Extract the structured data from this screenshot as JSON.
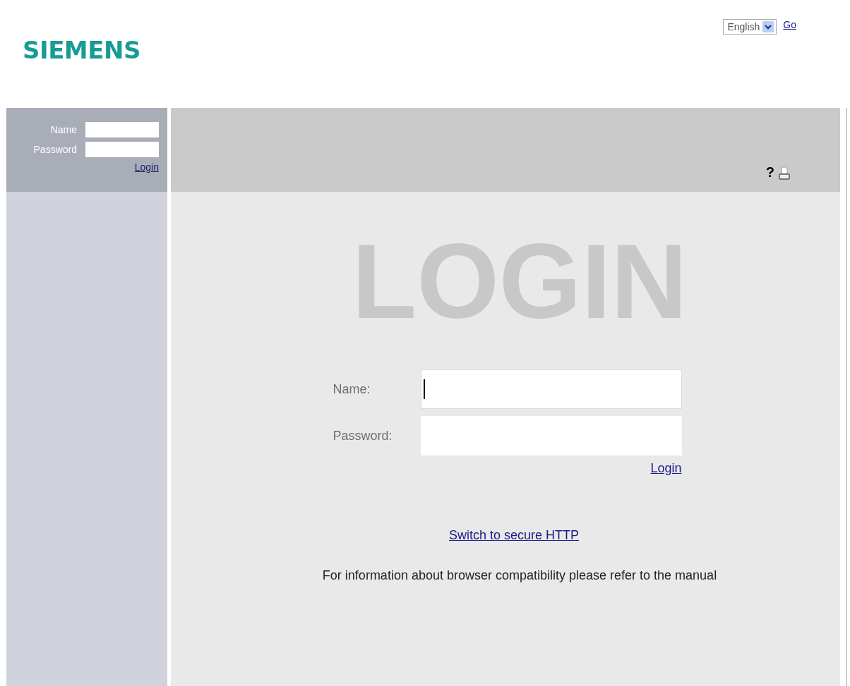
{
  "header": {
    "logo": "SIEMENS",
    "language": {
      "value": "English"
    },
    "go_link": "Go"
  },
  "sidebar": {
    "fields": [
      {
        "label": "Name"
      },
      {
        "label": "Password"
      }
    ],
    "login_link": "Login"
  },
  "toolbar": {
    "help": "?"
  },
  "main": {
    "watermark": "LOGIN",
    "fields": [
      {
        "label": "Name:",
        "focused": true
      },
      {
        "label": "Password:",
        "focused": false
      }
    ],
    "login_link": "Login",
    "secure_link": "Switch to secure HTTP",
    "info": "For information about browser compatibility please refer to the manual"
  }
}
